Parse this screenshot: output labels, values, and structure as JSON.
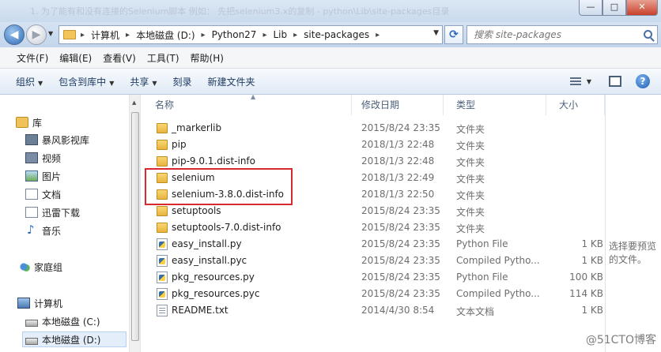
{
  "window": {
    "title": "1. 为了能有和没有连接的Selenium脚本 例如：  先把selenium3.x的复制 - python\\Lib\\site-packages目录",
    "buttons": {
      "minimize": "—",
      "maximize": "□",
      "close": "✕"
    }
  },
  "address": {
    "crumbs": [
      "计算机",
      "本地磁盘 (D:)",
      "Python27",
      "Lib",
      "site-packages"
    ],
    "separator": "▸",
    "search_placeholder": "搜索 site-packages"
  },
  "menu": [
    "文件(F)",
    "编辑(E)",
    "查看(V)",
    "工具(T)",
    "帮助(H)"
  ],
  "toolbar": [
    {
      "label": "组织",
      "dropdown": true
    },
    {
      "label": "包含到库中",
      "dropdown": true
    },
    {
      "label": "共享",
      "dropdown": true
    },
    {
      "label": "刻录",
      "dropdown": false
    },
    {
      "label": "新建文件夹",
      "dropdown": false
    }
  ],
  "nav": {
    "library": "库",
    "library_items": [
      "暴风影视库",
      "视频",
      "图片",
      "文档",
      "迅雷下载",
      "音乐"
    ],
    "homegroup": "家庭组",
    "computer": "计算机",
    "drives": [
      "本地磁盘 (C:)",
      "本地磁盘 (D:)"
    ],
    "selected_drive": "本地磁盘 (D:)"
  },
  "columns": {
    "name": "名称",
    "date": "修改日期",
    "type": "类型",
    "size": "大小"
  },
  "files": [
    {
      "name": "_markerlib",
      "date": "2015/8/24 23:35",
      "type": "文件夹",
      "size": "",
      "icon": "folder-icon"
    },
    {
      "name": "pip",
      "date": "2018/1/3 22:48",
      "type": "文件夹",
      "size": "",
      "icon": "folder-icon"
    },
    {
      "name": "pip-9.0.1.dist-info",
      "date": "2018/1/3 22:48",
      "type": "文件夹",
      "size": "",
      "icon": "folder-icon"
    },
    {
      "name": "selenium",
      "date": "2018/1/3 22:49",
      "type": "文件夹",
      "size": "",
      "icon": "folder-icon"
    },
    {
      "name": "selenium-3.8.0.dist-info",
      "date": "2018/1/3 22:50",
      "type": "文件夹",
      "size": "",
      "icon": "folder-icon"
    },
    {
      "name": "setuptools",
      "date": "2015/8/24 23:35",
      "type": "文件夹",
      "size": "",
      "icon": "folder-icon"
    },
    {
      "name": "setuptools-7.0.dist-info",
      "date": "2015/8/24 23:35",
      "type": "文件夹",
      "size": "",
      "icon": "folder-icon"
    },
    {
      "name": "easy_install.py",
      "date": "2015/8/24 23:35",
      "type": "Python File",
      "size": "1 KB",
      "icon": "python-file-icon"
    },
    {
      "name": "easy_install.pyc",
      "date": "2015/8/24 23:35",
      "type": "Compiled Pytho...",
      "size": "1 KB",
      "icon": "python-compiled-icon"
    },
    {
      "name": "pkg_resources.py",
      "date": "2015/8/24 23:35",
      "type": "Python File",
      "size": "100 KB",
      "icon": "python-file-icon"
    },
    {
      "name": "pkg_resources.pyc",
      "date": "2015/8/24 23:35",
      "type": "Compiled Pytho...",
      "size": "114 KB",
      "icon": "python-compiled-icon"
    },
    {
      "name": "README.txt",
      "date": "2014/4/30 8:54",
      "type": "文本文档",
      "size": "1 KB",
      "icon": "text-file-icon"
    }
  ],
  "highlight_color": "#d8292f",
  "preview": {
    "message": "选择要预览的文件。"
  },
  "watermark": "@51CTO博客"
}
